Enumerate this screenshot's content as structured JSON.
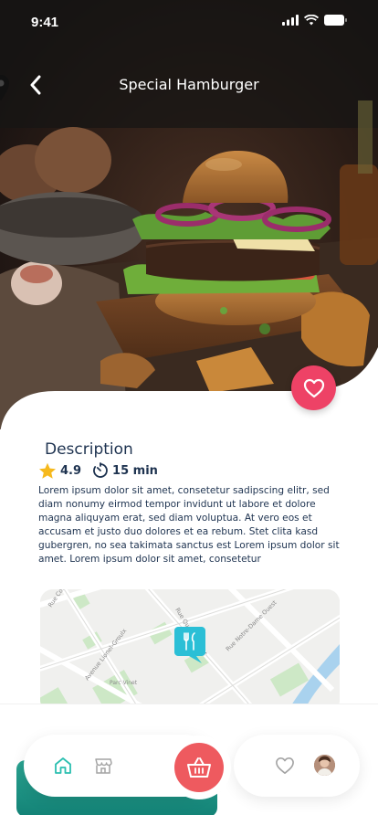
{
  "status_bar": {
    "time": "9:41"
  },
  "header": {
    "title": "Special Hamburger"
  },
  "description": {
    "heading": "Description",
    "rating": "4.9",
    "time": "15 min",
    "body": "Lorem ipsum dolor sit amet, consetetur sadipscing elitr, sed diam nonumy eirmod tempor invidunt ut labore et dolore magna aliquyam erat, sed diam voluptua. At vero eos et accusam et justo duo dolores et ea rebum. Stet clita kasd gubergren, no sea takimata sanctus est Lorem ipsum dolor sit amet. Lorem ipsum dolor sit amet, consetetur"
  },
  "map": {
    "street_labels": [
      "Rue Cours",
      "Rue Quesnel-Vinet",
      "Rue Notre-Dame Ouest",
      "Avenue Lionel-Groulx",
      "Parc Vinet"
    ]
  },
  "icons": {
    "back": "chevron-left-icon",
    "favorite": "heart-icon",
    "star": "star-icon",
    "timer": "timer-icon",
    "restaurant_pin": "fork-knife-pin-icon",
    "home": "home-icon",
    "store": "store-icon",
    "cart": "basket-icon",
    "heart_nav": "heart-outline-icon"
  },
  "colors": {
    "accent_red": "#ee4266",
    "cart_red": "#ee5a5f",
    "teal": "#2bbfd6",
    "text_dark": "#1e3350",
    "star": "#f6b91d"
  }
}
